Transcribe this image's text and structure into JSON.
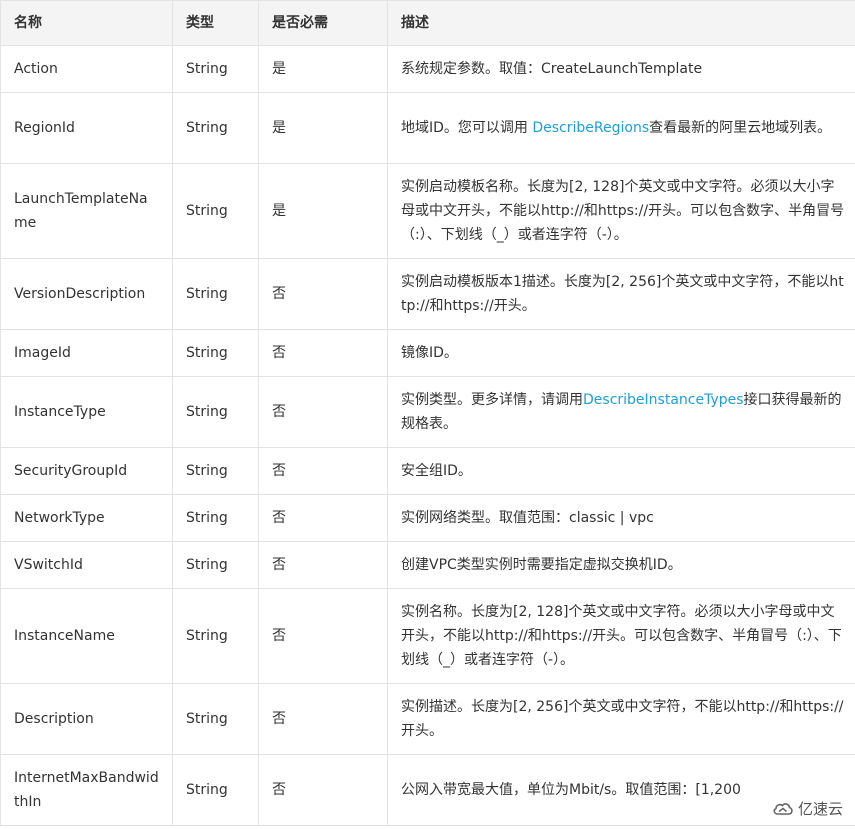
{
  "table": {
    "headers": [
      "名称",
      "类型",
      "是否必需",
      "描述"
    ],
    "rows": [
      {
        "name": "Action",
        "type": "String",
        "required": "是",
        "desc": [
          {
            "t": "系统规定参数。取值：CreateLaunchTemplate"
          }
        ]
      },
      {
        "name": "RegionId",
        "type": "String",
        "required": "是",
        "desc": [
          {
            "t": "地域ID。您可以调用 "
          },
          {
            "t": "DescribeRegions",
            "link": true
          },
          {
            "t": "查看最新的阿里云地域列表。"
          }
        ]
      },
      {
        "name": "LaunchTemplateName",
        "type": "String",
        "required": "是",
        "desc": [
          {
            "t": "实例启动模板名称。长度为[2, 128]个英文或中文字符。必须以大小字母或中文开头，不能以http://和https://开头。可以包含数字、半角冒号（:）、下划线（_）或者连字符（-）。"
          }
        ]
      },
      {
        "name": "VersionDescription",
        "type": "String",
        "required": "否",
        "desc": [
          {
            "t": "实例启动模板版本1描述。长度为[2, 256]个英文或中文字符，不能以http://和https://开头。"
          }
        ]
      },
      {
        "name": "ImageId",
        "type": "String",
        "required": "否",
        "desc": [
          {
            "t": "镜像ID。"
          }
        ]
      },
      {
        "name": "InstanceType",
        "type": "String",
        "required": "否",
        "desc": [
          {
            "t": "实例类型。更多详情，请调用"
          },
          {
            "t": "DescribeInstanceTypes",
            "link": true
          },
          {
            "t": "接口获得最新的规格表。"
          }
        ]
      },
      {
        "name": "SecurityGroupId",
        "type": "String",
        "required": "否",
        "desc": [
          {
            "t": "安全组ID。"
          }
        ]
      },
      {
        "name": "NetworkType",
        "type": "String",
        "required": "否",
        "desc": [
          {
            "t": "实例网络类型。取值范围：classic | vpc"
          }
        ]
      },
      {
        "name": "VSwitchId",
        "type": "String",
        "required": "否",
        "desc": [
          {
            "t": "创建VPC类型实例时需要指定虚拟交换机ID。"
          }
        ]
      },
      {
        "name": "InstanceName",
        "type": "String",
        "required": "否",
        "desc": [
          {
            "t": "实例名称。长度为[2, 128]个英文或中文字符。必须以大小字母或中文开头，不能以http://和https://开头。可以包含数字、半角冒号（:）、下划线（_）或者连字符（-）。"
          }
        ]
      },
      {
        "name": "Description",
        "type": "String",
        "required": "否",
        "desc": [
          {
            "t": "实例描述。长度为[2, 256]个英文或中文字符，不能以http://和https://开头。"
          }
        ]
      },
      {
        "name": "InternetMaxBandwidthIn",
        "type": "String",
        "required": "否",
        "desc": [
          {
            "t": "公网入带宽最大值，单位为Mbit/s。取值范围：[1,200"
          }
        ]
      }
    ]
  },
  "watermark": {
    "text": "亿速云",
    "icon": "cloud-logo-icon"
  },
  "colors": {
    "header_bg": "#f4f4f4",
    "border": "#e3e3e3",
    "link": "#1e9fd6",
    "text": "#333333"
  }
}
